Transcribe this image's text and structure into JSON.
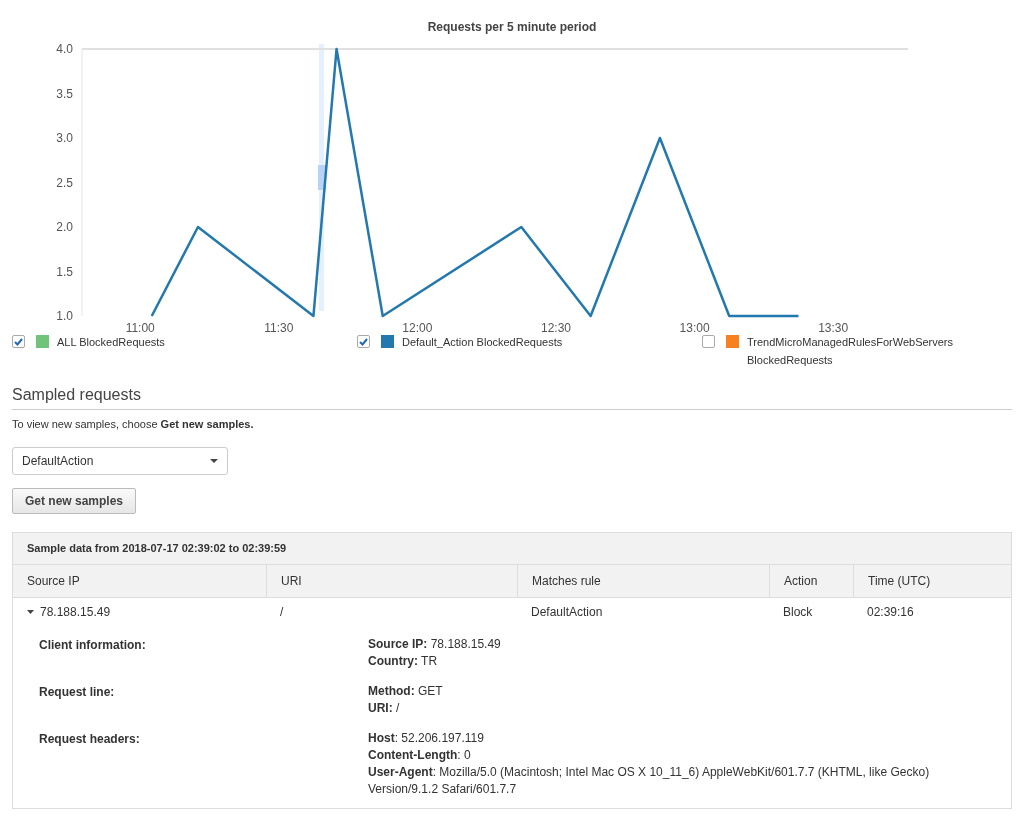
{
  "chart": {
    "chart_data": {
      "type": "line",
      "title": "Requests per 5 minute period",
      "x": [
        662.5,
        672.5,
        697.5,
        702.5,
        712.5,
        742.5,
        757.5,
        772.5,
        787.5,
        802.5
      ],
      "series": [
        {
          "name": "Default_Action BlockedRequests",
          "color": "#2378ae",
          "values": [
            1,
            2,
            1,
            4,
            1,
            2,
            1,
            3,
            1,
            1
          ]
        }
      ],
      "xlim": [
        647.4,
        826.2
      ],
      "ylim": [
        1,
        4
      ],
      "xticks": [
        {
          "value": 660,
          "label": "11:00"
        },
        {
          "value": 690,
          "label": "11:30"
        },
        {
          "value": 720,
          "label": "12:00"
        },
        {
          "value": 750,
          "label": "12:30"
        },
        {
          "value": 780,
          "label": "13:00"
        },
        {
          "value": 810,
          "label": "13:30"
        }
      ],
      "yticks": [
        {
          "value": 1,
          "label": "1.0"
        },
        {
          "value": 1.5,
          "label": "1.5"
        },
        {
          "value": 2,
          "label": "2.0"
        },
        {
          "value": 2.5,
          "label": "2.5"
        },
        {
          "value": 3,
          "label": "3.0"
        },
        {
          "value": 3.5,
          "label": "3.5"
        },
        {
          "value": 4,
          "label": "4.0"
        }
      ]
    },
    "legend": [
      {
        "kind": "other",
        "label": "ALL BlockedRequests",
        "checked": true,
        "color": "#6fc37a"
      },
      {
        "kind": "series",
        "checked": true
      },
      {
        "kind": "other",
        "label": "TrendMicroManagedRulesForWebServers BlockedRequests",
        "checked": false,
        "color": "#f7811e"
      }
    ]
  },
  "sampled": {
    "heading": "Sampled requests",
    "hint": "To view new samples, choose **Get new samples.**",
    "dropdown": "DefaultAction",
    "button": "Get new samples"
  },
  "table": {
    "caption": "Sample data from 2018-07-17 02:39:02 to 02:39:59",
    "columns": [
      "Source IP",
      "URI",
      "Matches rule",
      "Action",
      "Time (UTC)"
    ],
    "rows": [
      {
        "expanded": true,
        "cells": [
          "78.188.15.49",
          "/",
          "DefaultAction",
          "Block",
          "02:39:16"
        ],
        "details": [
          {
            "label": "Client information:",
            "lines": [
              "**Source IP:** 78.188.15.49",
              "**Country:** TR"
            ]
          },
          {
            "label": "Request line:",
            "lines": [
              "**Method:** GET",
              "**URI:** /"
            ]
          },
          {
            "label": "Request headers:",
            "lines": [
              "**Host**: 52.206.197.119",
              "**Content-Length**: 0",
              "**User-Agent**: Mozilla/5.0 (Macintosh; Intel Mac OS X 10_11_6) AppleWebKit/601.7.7 (KHTML, like Gecko) Version/9.1.2 Safari/601.7.7"
            ]
          }
        ]
      }
    ]
  }
}
